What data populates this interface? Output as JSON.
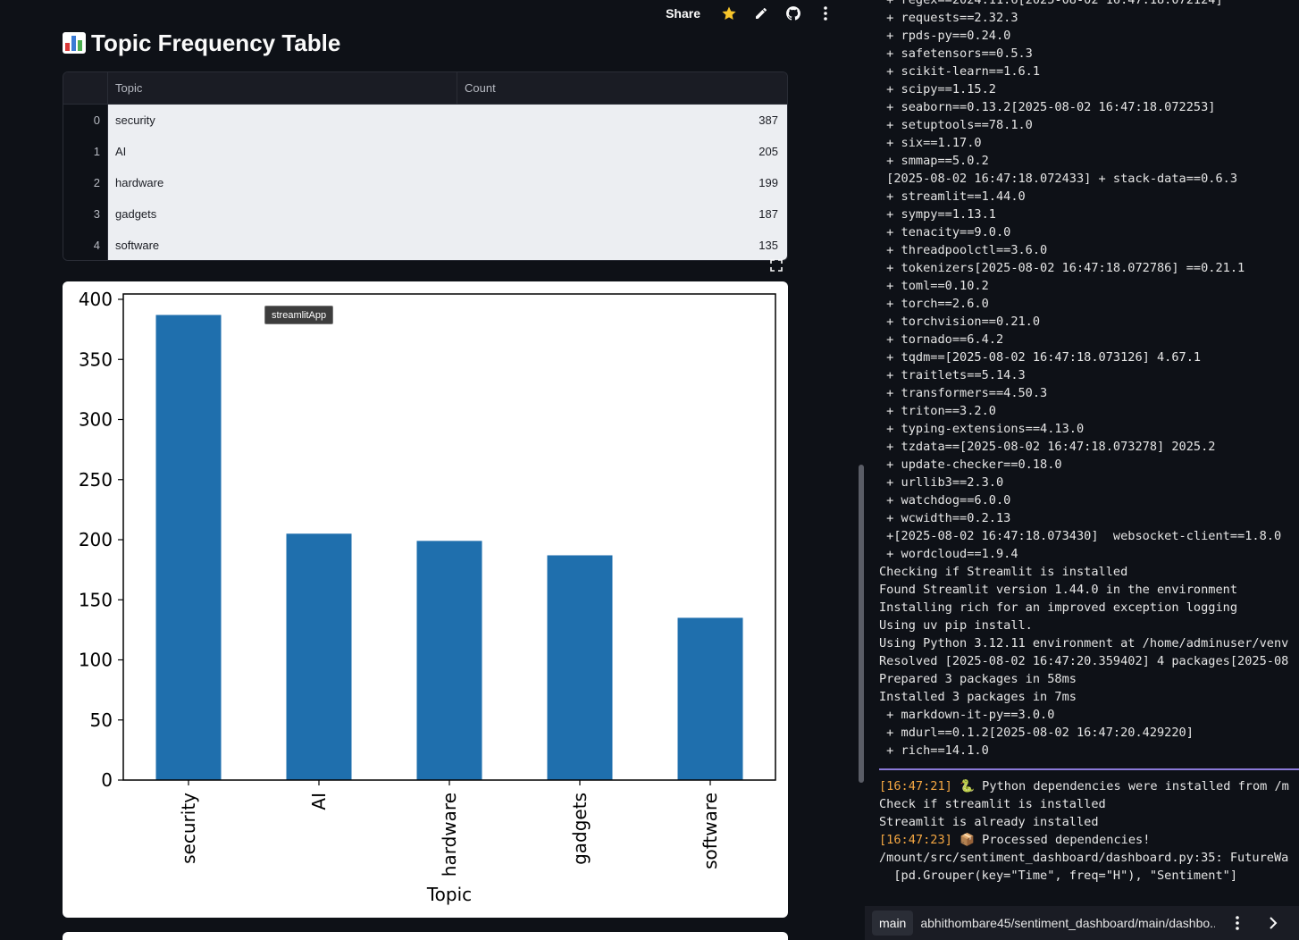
{
  "toolbar": {
    "share_label": "Share"
  },
  "page": {
    "title": "Topic Frequency Table"
  },
  "table": {
    "columns": [
      "",
      "Topic",
      "Count"
    ],
    "rows": [
      {
        "index": "0",
        "topic": "security",
        "count": "387"
      },
      {
        "index": "1",
        "topic": "AI",
        "count": "205"
      },
      {
        "index": "2",
        "topic": "hardware",
        "count": "199"
      },
      {
        "index": "3",
        "topic": "gadgets",
        "count": "187"
      },
      {
        "index": "4",
        "topic": "software",
        "count": "135"
      }
    ]
  },
  "tooltip": {
    "text": "streamlitApp"
  },
  "chart_data": {
    "type": "bar",
    "categories": [
      "security",
      "AI",
      "hardware",
      "gadgets",
      "software"
    ],
    "values": [
      387,
      205,
      199,
      187,
      135
    ],
    "title": "",
    "xlabel": "Topic",
    "ylabel": "",
    "ylim": [
      0,
      400
    ],
    "yticks": [
      0,
      50,
      100,
      150,
      200,
      250,
      300,
      350,
      400
    ],
    "bar_color": "#1f6fad",
    "grid": false
  },
  "logs": {
    "lines": [
      " + regex==2024.11.6[2025-08-02 16:47:18.072124]",
      " + requests==2.32.3",
      " + rpds-py==0.24.0",
      " + safetensors==0.5.3",
      " + scikit-learn==1.6.1",
      " + scipy==1.15.2",
      " + seaborn==0.13.2[2025-08-02 16:47:18.072253]",
      " + setuptools==78.1.0",
      " + six==1.17.0",
      " + smmap==5.0.2",
      " [2025-08-02 16:47:18.072433] + stack-data==0.6.3",
      " + streamlit==1.44.0",
      " + sympy==1.13.1",
      " + tenacity==9.0.0",
      " + threadpoolctl==3.6.0",
      " + tokenizers[2025-08-02 16:47:18.072786] ==0.21.1",
      " + toml==0.10.2",
      " + torch==2.6.0",
      " + torchvision==0.21.0",
      " + tornado==6.4.2",
      " + tqdm==[2025-08-02 16:47:18.073126] 4.67.1",
      " + traitlets==5.14.3",
      " + transformers==4.50.3",
      " + triton==3.2.0",
      " + typing-extensions==4.13.0",
      " + tzdata==[2025-08-02 16:47:18.073278] 2025.2",
      " + update-checker==0.18.0",
      " + urllib3==2.3.0",
      " + watchdog==6.0.0",
      " + wcwidth==0.2.13",
      " +[2025-08-02 16:47:18.073430]  websocket-client==1.8.0",
      " + wordcloud==1.9.4",
      "Checking if Streamlit is installed",
      "Found Streamlit version 1.44.0 in the environment",
      "Installing rich for an improved exception logging",
      "Using uv pip install.",
      "Using Python 3.12.11 environment at /home/adminuser/venv",
      "Resolved [2025-08-02 16:47:20.359402] 4 packages[2025-08",
      "Prepared 3 packages in 58ms",
      "Installed 3 packages in 7ms",
      " + markdown-it-py==3.0.0",
      " + mdurl==0.1.2[2025-08-02 16:47:20.429220]",
      " + rich==14.1.0"
    ],
    "after_sep": [
      {
        "ts": "[16:47:21]",
        "text": " 🐍 Python dependencies were installed from /m"
      },
      {
        "ts": "",
        "text": "Check if streamlit is installed"
      },
      {
        "ts": "",
        "text": "Streamlit is already installed"
      },
      {
        "ts": "[16:47:23]",
        "text": " 📦 Processed dependencies!"
      },
      {
        "ts": "",
        "text": "/mount/src/sentiment_dashboard/dashboard.py:35: FutureWa"
      },
      {
        "ts": "",
        "text": "  [pd.Grouper(key=\"Time\", freq=\"H\"), \"Sentiment\"]"
      }
    ]
  },
  "footer": {
    "branch": "main",
    "path": "abhithombare45/sentiment_dashboard/main/dashbo..."
  }
}
